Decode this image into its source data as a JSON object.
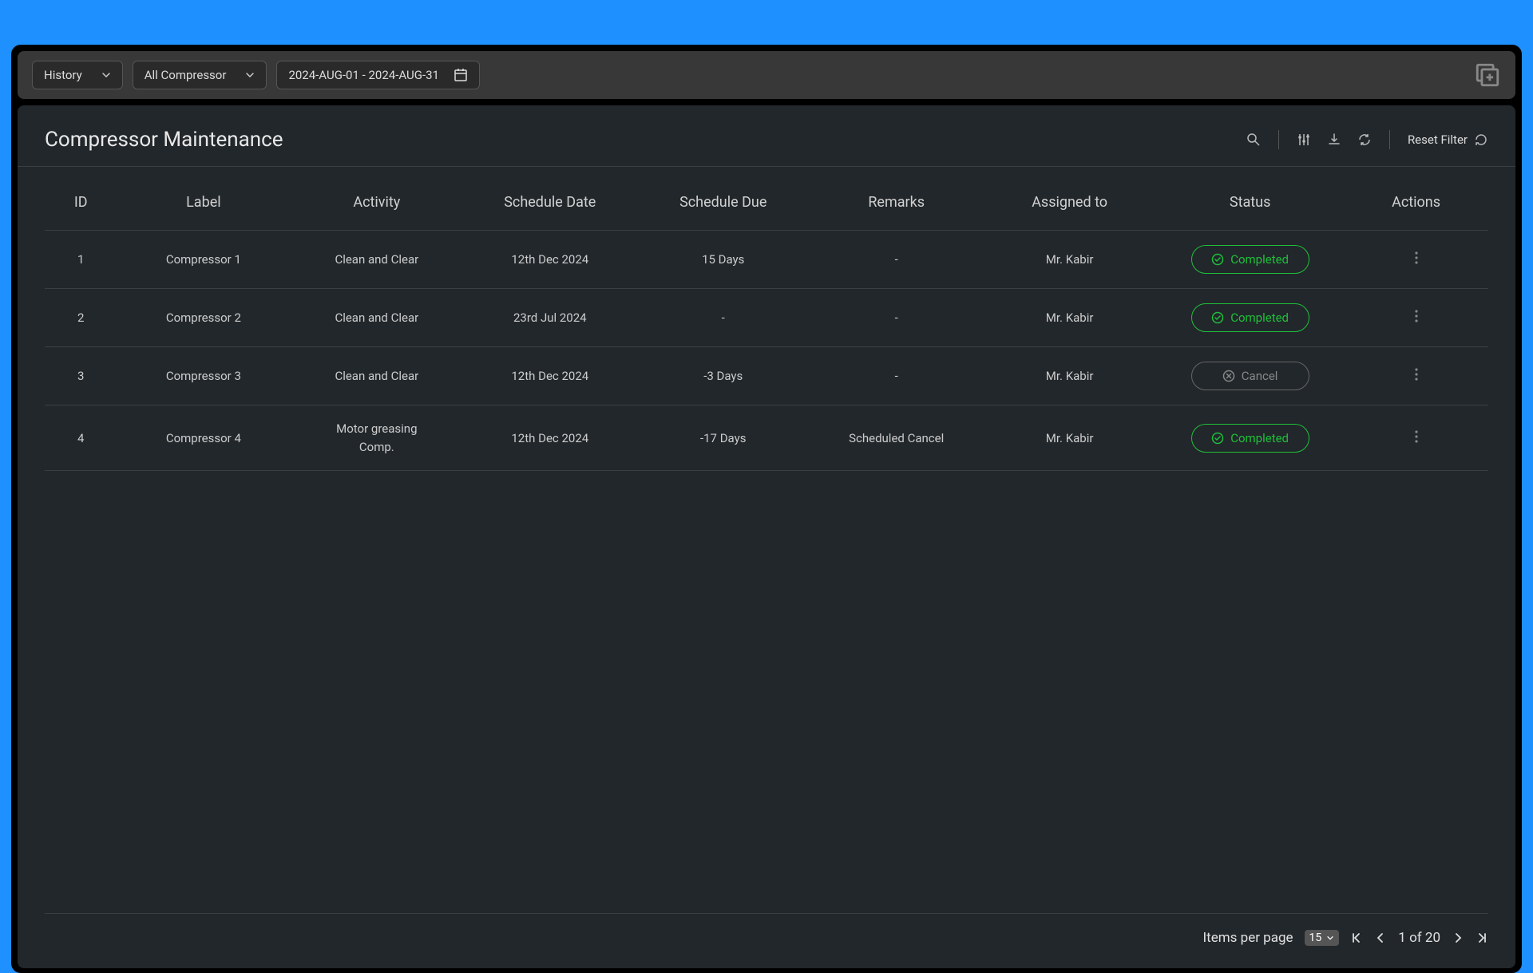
{
  "toolbar": {
    "view_select": "History",
    "compressor_select": "All Compressor",
    "date_range": "2024-AUG-01 - 2024-AUG-31"
  },
  "panel": {
    "title": "Compressor Maintenance",
    "reset_filter": "Reset Filter"
  },
  "columns": {
    "id": "ID",
    "label": "Label",
    "activity": "Activity",
    "schedule_date": "Schedule Date",
    "schedule_due": "Schedule Due",
    "remarks": "Remarks",
    "assigned_to": "Assigned to",
    "status": "Status",
    "actions": "Actions"
  },
  "status_labels": {
    "completed": "Completed",
    "cancel": "Cancel"
  },
  "rows": [
    {
      "id": "1",
      "label": "Compressor 1",
      "activity": "Clean and Clear",
      "schedule_date": "12th Dec 2024",
      "schedule_due": "15 Days",
      "remarks": "-",
      "assigned_to": "Mr. Kabir",
      "status": "completed"
    },
    {
      "id": "2",
      "label": "Compressor 2",
      "activity": "Clean and Clear",
      "schedule_date": "23rd Jul 2024",
      "schedule_due": "-",
      "remarks": "-",
      "assigned_to": "Mr. Kabir",
      "status": "completed"
    },
    {
      "id": "3",
      "label": "Compressor 3",
      "activity": "Clean and Clear",
      "schedule_date": "12th Dec 2024",
      "schedule_due": "-3 Days",
      "remarks": "-",
      "assigned_to": "Mr. Kabir",
      "status": "cancel"
    },
    {
      "id": "4",
      "label": "Compressor 4",
      "activity": "Motor greasing Comp.",
      "schedule_date": "12th Dec 2024",
      "schedule_due": "-17 Days",
      "remarks": "Scheduled Cancel",
      "assigned_to": "Mr. Kabir",
      "status": "completed"
    }
  ],
  "footer": {
    "items_per_page_label": "Items per page",
    "items_per_page_value": "15",
    "page_info": "1 of 20"
  }
}
